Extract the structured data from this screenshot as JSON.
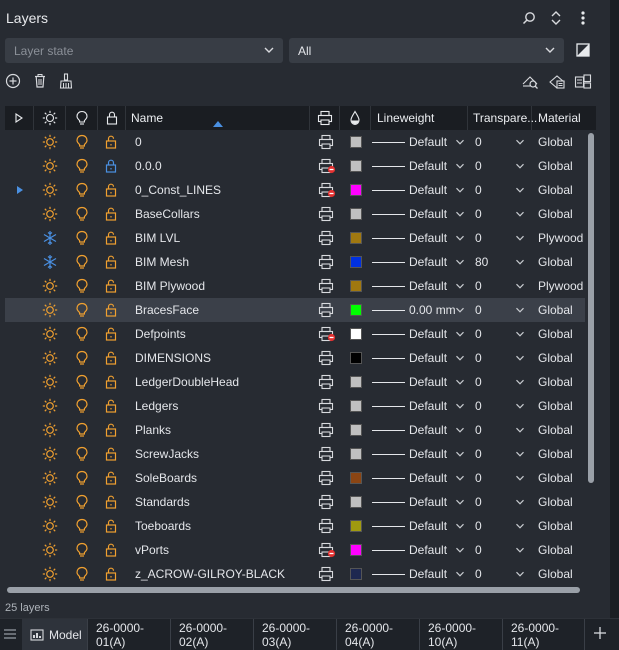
{
  "panel": {
    "title": "Layers",
    "layer_state_placeholder": "Layer state",
    "filter_value": "All",
    "status": "25 layers"
  },
  "columns": {
    "name": "Name",
    "lineweight": "Lineweight",
    "transparency": "Transpare...",
    "material": "Material"
  },
  "colors": {
    "on_icon": "#f0a030",
    "frozen_icon": "#4a90e2",
    "lock_icon": "#f0a030",
    "accent": "#4a90e2"
  },
  "layers": [
    {
      "name": "0",
      "frozen": false,
      "lock": "open",
      "plot": "print",
      "color": "#c0c0c0",
      "lineweight": "Default",
      "transparency": "0",
      "material": "Global",
      "expand": false
    },
    {
      "name": "0.0.0",
      "frozen": false,
      "lock": "locked",
      "plot": "no-print",
      "color": "#c0c0c0",
      "lineweight": "Default",
      "transparency": "0",
      "material": "Global",
      "expand": false
    },
    {
      "name": "0_Const_LINES",
      "frozen": false,
      "lock": "open",
      "plot": "no-print",
      "color": "#ff00ff",
      "lineweight": "Default",
      "transparency": "0",
      "material": "Global",
      "expand": true
    },
    {
      "name": "BaseCollars",
      "frozen": false,
      "lock": "open",
      "plot": "print",
      "color": "#c0c0c0",
      "lineweight": "Default",
      "transparency": "0",
      "material": "Global",
      "expand": false
    },
    {
      "name": "BIM LVL",
      "frozen": true,
      "lock": "open",
      "plot": "print",
      "color": "#a07810",
      "lineweight": "Default",
      "transparency": "0",
      "material": "Plywood",
      "expand": false
    },
    {
      "name": "BIM Mesh",
      "frozen": true,
      "lock": "open",
      "plot": "print",
      "color": "#0030e0",
      "lineweight": "Default",
      "transparency": "80",
      "material": "Global",
      "expand": false
    },
    {
      "name": "BIM Plywood",
      "frozen": false,
      "lock": "open",
      "plot": "print",
      "color": "#a07810",
      "lineweight": "Default",
      "transparency": "0",
      "material": "Plywood",
      "expand": false
    },
    {
      "name": "BracesFace",
      "frozen": false,
      "lock": "open",
      "plot": "print",
      "color": "#00ff00",
      "lineweight": "0.00 mm",
      "transparency": "0",
      "material": "Global",
      "expand": false,
      "selected": true
    },
    {
      "name": "Defpoints",
      "frozen": false,
      "lock": "open",
      "plot": "no-print",
      "color": "#ffffff",
      "lineweight": "Default",
      "transparency": "0",
      "material": "Global",
      "expand": false
    },
    {
      "name": "DIMENSIONS",
      "frozen": false,
      "lock": "open",
      "plot": "print",
      "color": "#000000",
      "lineweight": "Default",
      "transparency": "0",
      "material": "Global",
      "expand": false
    },
    {
      "name": "LedgerDoubleHead",
      "frozen": false,
      "lock": "open",
      "plot": "print",
      "color": "#c0c0c0",
      "lineweight": "Default",
      "transparency": "0",
      "material": "Global",
      "expand": false
    },
    {
      "name": "Ledgers",
      "frozen": false,
      "lock": "open",
      "plot": "print",
      "color": "#c0c0c0",
      "lineweight": "Default",
      "transparency": "0",
      "material": "Global",
      "expand": false
    },
    {
      "name": "Planks",
      "frozen": false,
      "lock": "open",
      "plot": "print",
      "color": "#c0c0c0",
      "lineweight": "Default",
      "transparency": "0",
      "material": "Global",
      "expand": false
    },
    {
      "name": "ScrewJacks",
      "frozen": false,
      "lock": "open",
      "plot": "print",
      "color": "#c0c0c0",
      "lineweight": "Default",
      "transparency": "0",
      "material": "Global",
      "expand": false
    },
    {
      "name": "SoleBoards",
      "frozen": false,
      "lock": "open",
      "plot": "print",
      "color": "#8b4513",
      "lineweight": "Default",
      "transparency": "0",
      "material": "Global",
      "expand": false
    },
    {
      "name": "Standards",
      "frozen": false,
      "lock": "open",
      "plot": "print",
      "color": "#c0c0c0",
      "lineweight": "Default",
      "transparency": "0",
      "material": "Global",
      "expand": false
    },
    {
      "name": "Toeboards",
      "frozen": false,
      "lock": "open",
      "plot": "print",
      "color": "#a09a10",
      "lineweight": "Default",
      "transparency": "0",
      "material": "Global",
      "expand": false
    },
    {
      "name": "vPorts",
      "frozen": false,
      "lock": "open",
      "plot": "no-print",
      "color": "#ff00ff",
      "lineweight": "Default",
      "transparency": "0",
      "material": "Global",
      "expand": false
    },
    {
      "name": "z_ACROW-GILROY-BLACK",
      "frozen": false,
      "lock": "open",
      "plot": "print",
      "color": "#1e2850",
      "lineweight": "Default",
      "transparency": "0",
      "material": "Global",
      "expand": false
    }
  ],
  "tabs": [
    "Model",
    "26-0000-01(A)",
    "26-0000-02(A)",
    "26-0000-03(A)",
    "26-0000-04(A)",
    "26-0000-10(A)",
    "26-0000-11(A)"
  ]
}
